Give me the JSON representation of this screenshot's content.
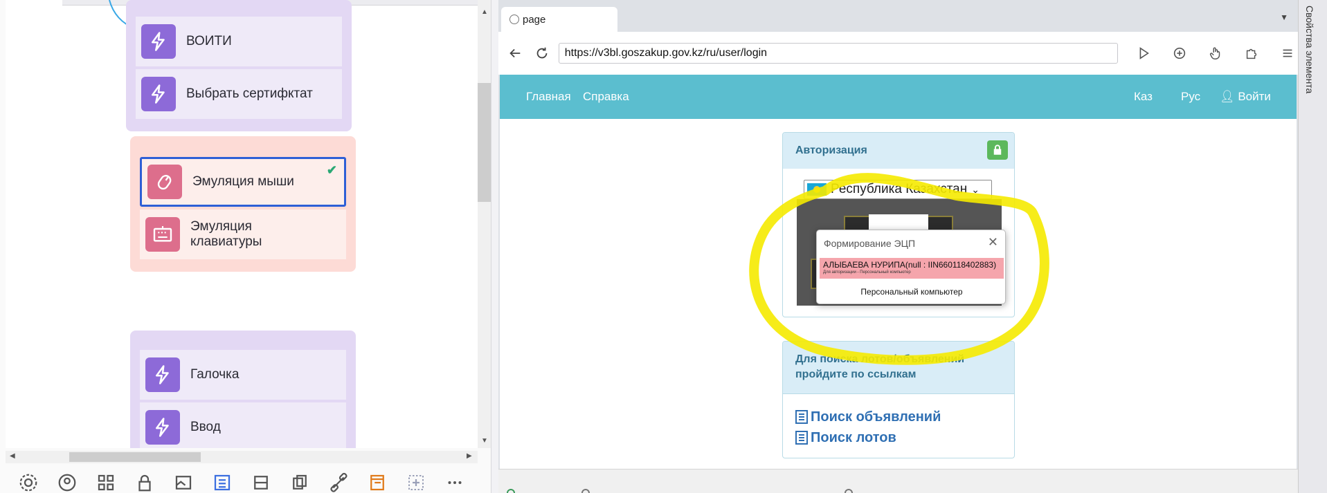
{
  "workflow": {
    "groups": [
      {
        "nodes": [
          {
            "label": "ВОИТИ"
          },
          {
            "label": "Выбрать сертифктат"
          }
        ]
      },
      {
        "nodes": [
          {
            "label": "Эмуляция мыши"
          },
          {
            "label": "Эмуляция клавиатуры"
          }
        ]
      },
      {
        "nodes": [
          {
            "label": "Галочка"
          },
          {
            "label": "Ввод"
          }
        ]
      }
    ]
  },
  "browser": {
    "tab_title": "page",
    "url": "https://v3bl.goszakup.gov.kz/ru/user/login"
  },
  "site": {
    "nav": {
      "home": "Главная",
      "help": "Справка",
      "kaz": "Каз",
      "rus": "Рус",
      "login": "Войти"
    },
    "auth_panel": {
      "title": "Авторизация",
      "country": "Республика Казахстан"
    },
    "dialog": {
      "title": "Формирование ЭЦП",
      "cert_name": "АЛЫБАЕВА НУРИПА(null : IIN660118402883)",
      "cert_note": "Для авторизации - Персональный компьютер",
      "footer": "Персональный компьютер"
    },
    "search_panel": {
      "title": "Для поиска лотов/объявлений пройдите по ссылкам",
      "links": [
        "Поиск объявлений",
        "Поиск лотов"
      ]
    }
  },
  "sidebar": {
    "title": "Свойства элемента"
  },
  "colors": {
    "nav_bg": "#5bbecf",
    "highlight": "#f5ea00",
    "accent_purple": "#8d6ad8",
    "accent_pink": "#dd6e8c"
  }
}
